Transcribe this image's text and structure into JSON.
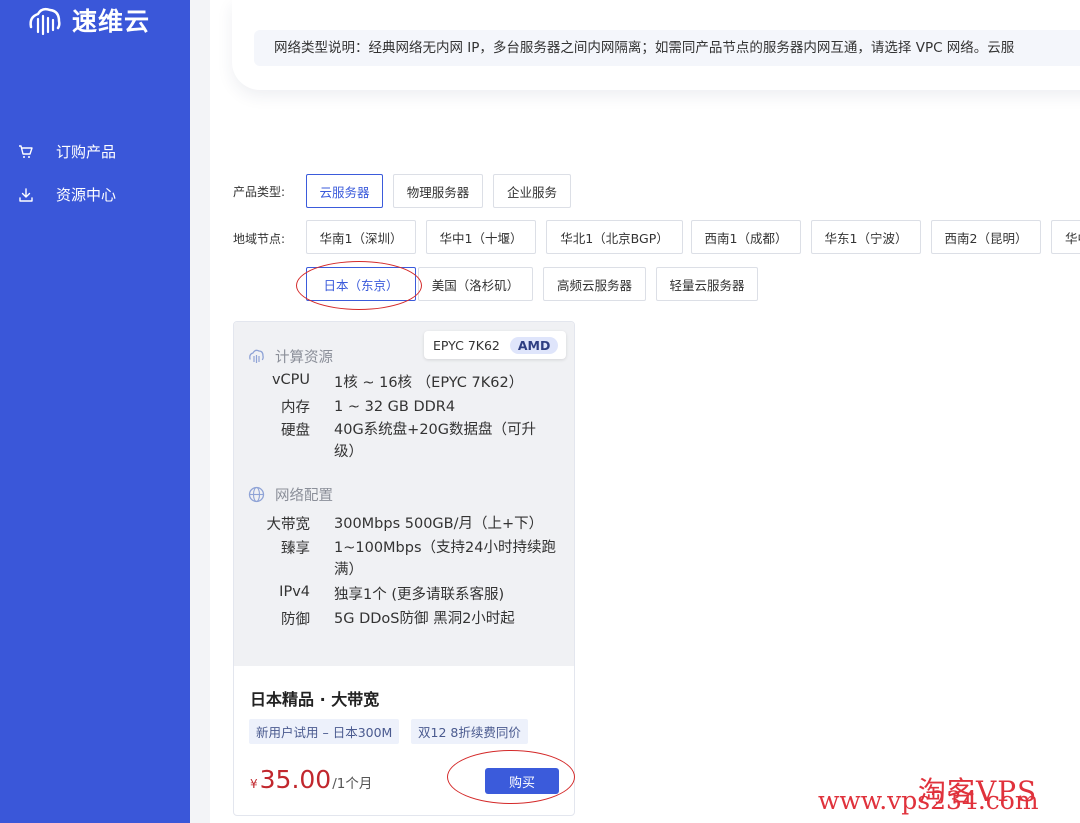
{
  "brand": {
    "name": "速维云"
  },
  "sidebar": {
    "items": [
      {
        "label": "订购产品",
        "icon": "cart-icon"
      },
      {
        "label": "资源中心",
        "icon": "download-icon"
      }
    ]
  },
  "notice": {
    "text": "网络类型说明：经典网络无内网 IP，多台服务器之间内网隔离；如需同产品节点的服务器内网互通，请选择 VPC 网络。云服"
  },
  "product_type": {
    "label": "产品类型:",
    "options": [
      "云服务器",
      "物理服务器",
      "企业服务"
    ],
    "selected": "云服务器"
  },
  "region": {
    "label": "地域节点:",
    "row1": [
      "华南1（深圳）",
      "华中1（十堰）",
      "华北1（北京BGP）",
      "西南1（成都）",
      "华东1（宁波）",
      "西南2（昆明）",
      "华中"
    ],
    "row2": [
      "日本（东京）",
      "美国（洛杉矶）",
      "高频云服务器",
      "轻量云服务器"
    ],
    "selected": "日本（东京）"
  },
  "card": {
    "cpu_model": "EPYC 7K62",
    "cpu_brand": "AMD",
    "compute": {
      "title": "计算资源",
      "specs": [
        {
          "key": "vCPU",
          "value": "1核 ~ 16核 （EPYC 7K62）"
        },
        {
          "key": "内存",
          "value": "1 ~ 32 GB DDR4"
        },
        {
          "key": "硬盘",
          "value": "40G系统盘+20G数据盘（可升级）"
        }
      ]
    },
    "network": {
      "title": "网络配置",
      "specs": [
        {
          "key": "大带宽",
          "value": "300Mbps 500GB/月（上+下）"
        },
        {
          "key": "臻享",
          "value": "1~100Mbps（支持24小时持续跑满）"
        },
        {
          "key": "IPv4",
          "value": "独享1个 (更多请联系客服)"
        },
        {
          "key": "防御",
          "value": "5G DDoS防御 黑洞2小时起"
        }
      ]
    },
    "name": "日本精品 · 大带宽",
    "tags": [
      "新用户试用 – 日本300M",
      "双12 8折续费同价"
    ],
    "price": {
      "symbol": "¥",
      "amount": "35.00",
      "unit": "/1个月"
    },
    "buy_label": "购买"
  },
  "watermark": {
    "cn": "淘客VPS",
    "url": "www.vps234.com"
  },
  "colors": {
    "sidebar": "#3a57d9",
    "accent": "#3b5bdb",
    "price": "#c1272d",
    "annotation": "#d42a2a"
  }
}
